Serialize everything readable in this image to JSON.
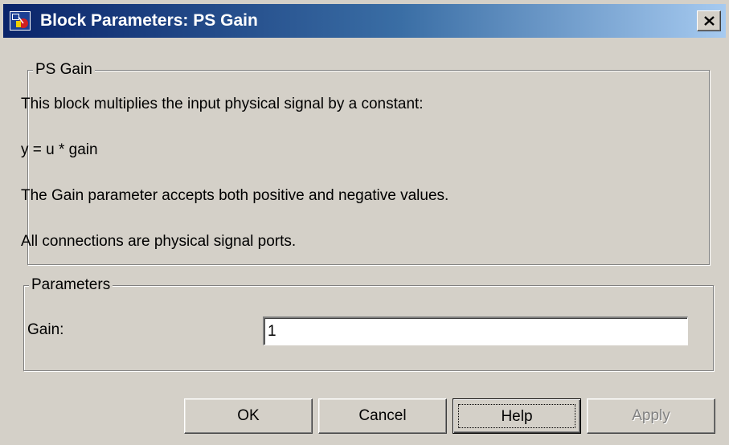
{
  "window": {
    "title": "Block Parameters: PS Gain",
    "icon": "simulink-block-icon",
    "close_icon": "close-icon"
  },
  "description_group": {
    "legend": "PS Gain",
    "lines": [
      "This block multiplies the input physical signal by a constant:",
      "y = u * gain",
      "The Gain parameter accepts both positive and negative values.",
      "All connections are physical signal ports."
    ]
  },
  "parameters_group": {
    "legend": "Parameters",
    "gain_label": "Gain:",
    "gain_value": "1"
  },
  "buttons": {
    "ok": "OK",
    "cancel": "Cancel",
    "help": "Help",
    "apply": "Apply"
  },
  "colors": {
    "title_gradient_start": "#0a246a",
    "title_gradient_end": "#a6caf0",
    "dialog_face": "#d4d0c8"
  }
}
